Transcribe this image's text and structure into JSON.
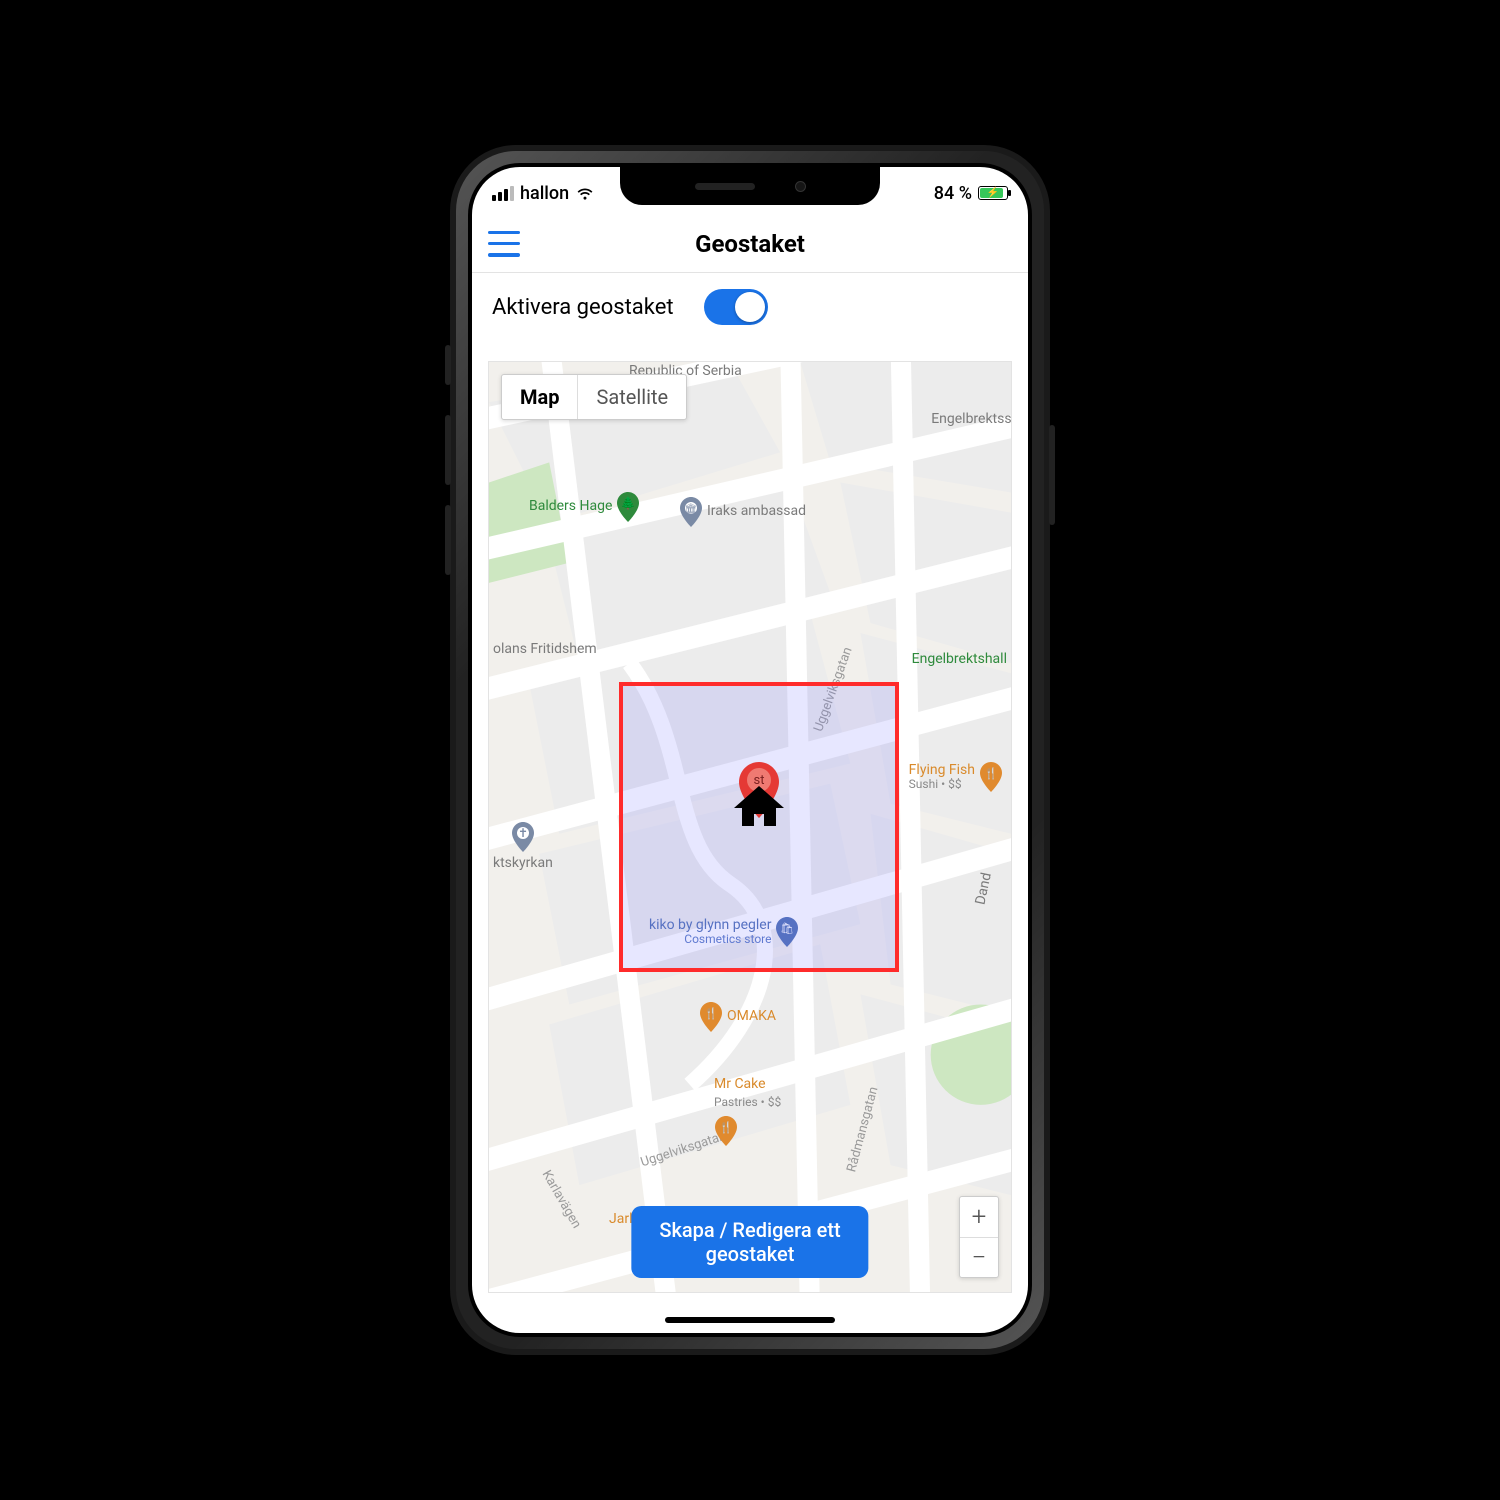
{
  "statusbar": {
    "carrier": "hallon",
    "battery_pct": "84 %"
  },
  "navbar": {
    "title": "Geostaket"
  },
  "activate": {
    "label": "Aktivera geostaket",
    "enabled": true
  },
  "maptype": {
    "map": "Map",
    "satellite": "Satellite",
    "active": "map"
  },
  "fragments": {
    "top_partial": "Republic of Serbia",
    "right_partial": "Engelbrektssl"
  },
  "pois": {
    "balders_hage": "Balders Hage",
    "iraks_ambassad": "Iraks ambassad",
    "engelbrektshall": "Engelbrektshall",
    "olans_fritidshem": "olans Fritidshem",
    "ktskyrkan": "ktskyrkan",
    "flying_fish": "Flying Fish",
    "flying_fish_sub": "Sushi • $$",
    "kiko": "kiko by glynn pegler",
    "kiko_sub": "Cosmetics store",
    "omaka": "OMAKA",
    "mr_cake": "Mr Cake",
    "mr_cake_sub": "Pastries • $$",
    "jarla_grillen": "Jarla Grillen",
    "dand": "Dand"
  },
  "streets": {
    "uggelviksgatan": "Uggelviksgatan",
    "uggelviksgatan2": "Uggelviksgatan",
    "radmansgatan": "Rådmansgatan",
    "karlavagen": "Karlavägen"
  },
  "marker": {
    "label": "st"
  },
  "action": {
    "label": "Skapa / Redigera ett\ngeostaket"
  },
  "zoom": {
    "in": "+",
    "out": "−"
  }
}
